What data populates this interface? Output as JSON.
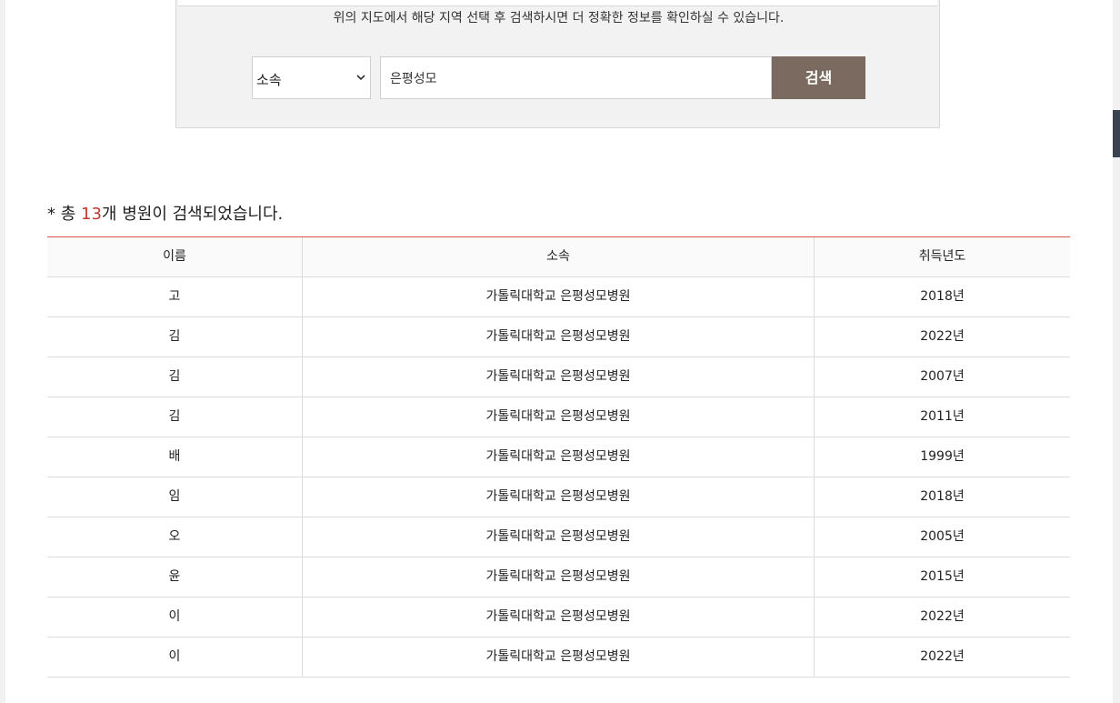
{
  "search": {
    "hint": "위의 지도에서 해당 지역 선택 후 검색하시면 더 정확한 정보를 확인하실 수 있습니다.",
    "select_value": "소속",
    "input_value": "은평성모",
    "button_label": "검색"
  },
  "result": {
    "prefix": "* 총 ",
    "count": "13",
    "suffix": "개 병원이 검색되었습니다."
  },
  "table": {
    "headers": [
      "이름",
      "소속",
      "취득년도"
    ],
    "rows": [
      {
        "name": "고",
        "org": "가톨릭대학교 은평성모병원",
        "year": "2018년"
      },
      {
        "name": "김",
        "org": "가톨릭대학교 은평성모병원",
        "year": "2022년"
      },
      {
        "name": "김",
        "org": "가톨릭대학교 은평성모병원",
        "year": "2007년"
      },
      {
        "name": "김",
        "org": "가톨릭대학교 은평성모병원",
        "year": "2011년"
      },
      {
        "name": "배",
        "org": "가톨릭대학교 은평성모병원",
        "year": "1999년"
      },
      {
        "name": "임",
        "org": "가톨릭대학교 은평성모병원",
        "year": "2018년"
      },
      {
        "name": "오",
        "org": "가톨릭대학교 은평성모병원",
        "year": "2005년"
      },
      {
        "name": "윤",
        "org": "가톨릭대학교 은평성모병원",
        "year": "2015년"
      },
      {
        "name": "이",
        "org": "가톨릭대학교 은평성모병원",
        "year": "2022년"
      },
      {
        "name": "이",
        "org": "가톨릭대학교 은평성모병원",
        "year": "2022년"
      }
    ]
  }
}
